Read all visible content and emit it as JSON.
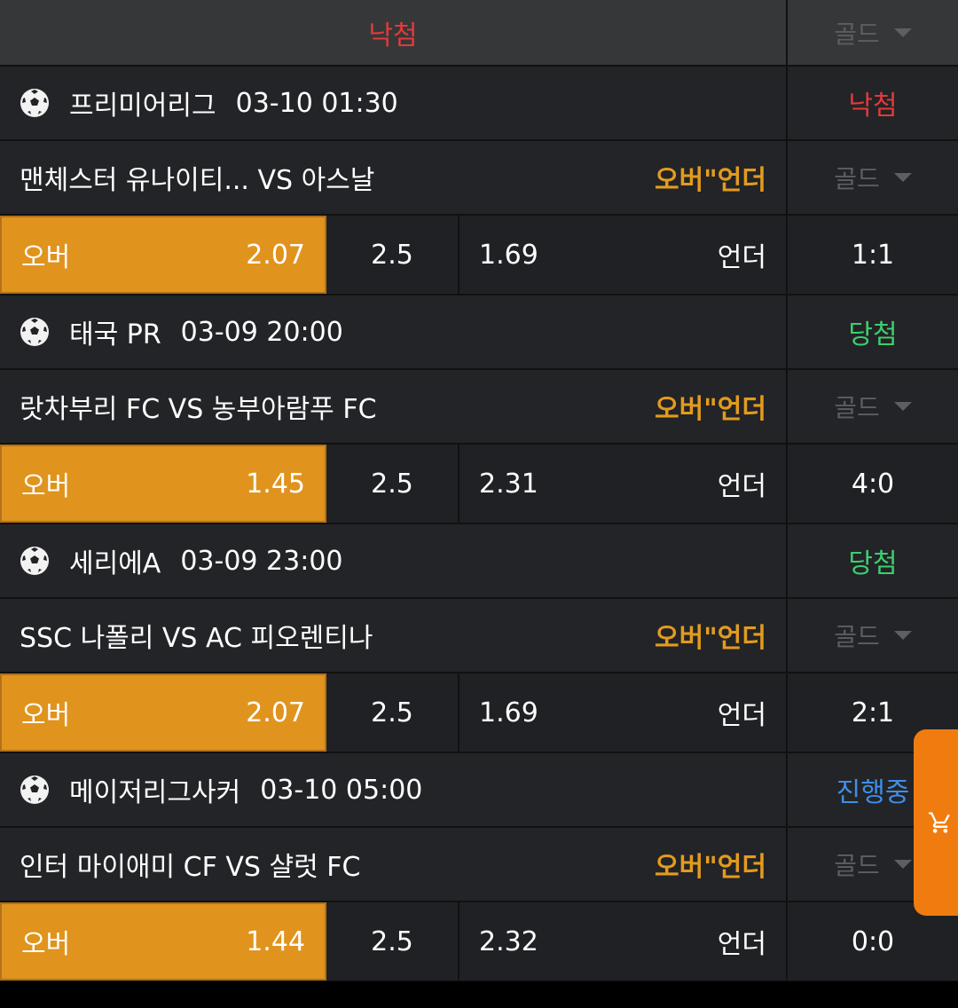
{
  "topbar": {
    "status": "낙첨",
    "gold_dropdown": "골드"
  },
  "games": [
    {
      "league": "프리미어리그",
      "datetime": "03-10 01:30",
      "status": "낙첨",
      "status_color": "#e23a3a",
      "teams": "맨체스터 유나이티...  VS 아스날",
      "market": "오버\"언더",
      "gold_dropdown": "골드",
      "over_label": "오버",
      "over_odds": "2.07",
      "line": "2.5",
      "under_odds": "1.69",
      "under_label": "언더",
      "score": "1:1"
    },
    {
      "league": "태국 PR",
      "datetime": "03-09 20:00",
      "status": "당첨",
      "status_color": "#3ccf6e",
      "teams": "랏차부리 FC VS 농부아람푸 FC",
      "market": "오버\"언더",
      "gold_dropdown": "골드",
      "over_label": "오버",
      "over_odds": "1.45",
      "line": "2.5",
      "under_odds": "2.31",
      "under_label": "언더",
      "score": "4:0"
    },
    {
      "league": "세리에A",
      "datetime": "03-09 23:00",
      "status": "당첨",
      "status_color": "#3ccf6e",
      "teams": "SSC 나폴리 VS AC 피오렌티나",
      "market": "오버\"언더",
      "gold_dropdown": "골드",
      "over_label": "오버",
      "over_odds": "2.07",
      "line": "2.5",
      "under_odds": "1.69",
      "under_label": "언더",
      "score": "2:1"
    },
    {
      "league": "메이저리그사커",
      "datetime": "03-10 05:00",
      "status": "진행중",
      "status_color": "#3f8ee8",
      "teams": "인터 마이애미 CF VS 샬럿 FC",
      "market": "오버\"언더",
      "gold_dropdown": "골드",
      "over_label": "오버",
      "over_odds": "1.44",
      "line": "2.5",
      "under_odds": "2.32",
      "under_label": "언더",
      "score": "0:0"
    }
  ],
  "icons": {
    "ball": "soccer-ball-icon",
    "cart": "shopping-cart-icon",
    "dropdown": "chevron-down-icon"
  },
  "colors": {
    "accent": "#e0941e",
    "market_text": "#e39b1e",
    "cart_tab": "#f07c10"
  }
}
